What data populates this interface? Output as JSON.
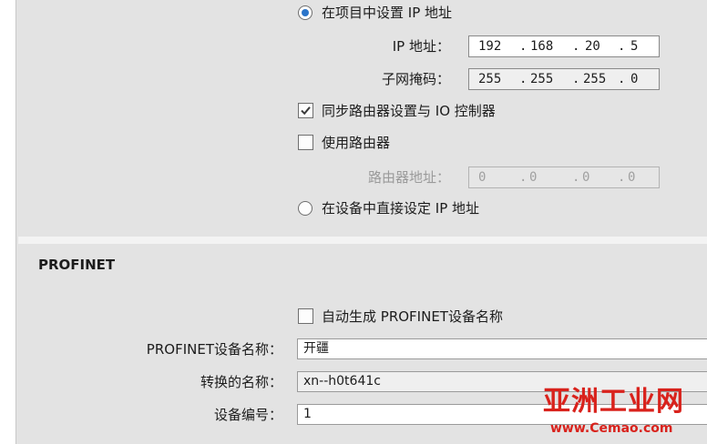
{
  "ip_section": {
    "option_project": "在项目中设置 IP 地址",
    "ip_label": "IP 地址：",
    "ip": [
      "192",
      "168",
      "20",
      "5"
    ],
    "mask_label": "子网掩码：",
    "mask": [
      "255",
      "255",
      "255",
      "0"
    ],
    "sync_router_label": "同步路由器设置与 IO 控制器",
    "sync_router_checked": true,
    "use_router_label": "使用路由器",
    "use_router_checked": false,
    "router_label": "路由器地址：",
    "router": [
      "0",
      "0",
      "0",
      "0"
    ],
    "option_device": "在设备中直接设定 IP 地址",
    "selected_option": "project"
  },
  "profinet": {
    "title": "PROFINET",
    "auto_name_label": "自动生成 PROFINET设备名称",
    "auto_name_checked": false,
    "device_name_label": "PROFINET设备名称：",
    "device_name_value": "开疆",
    "converted_name_label": "转换的名称：",
    "converted_name_value": "xn--h0t641c",
    "device_number_label": "设备编号：",
    "device_number_value": "1"
  },
  "watermark": {
    "brand": "亚洲工业网",
    "url": "www.Cemao.com"
  },
  "colors": {
    "panel": "#e3e3e3",
    "radio_selected": "#2a74c9",
    "watermark": "#d9221c"
  }
}
